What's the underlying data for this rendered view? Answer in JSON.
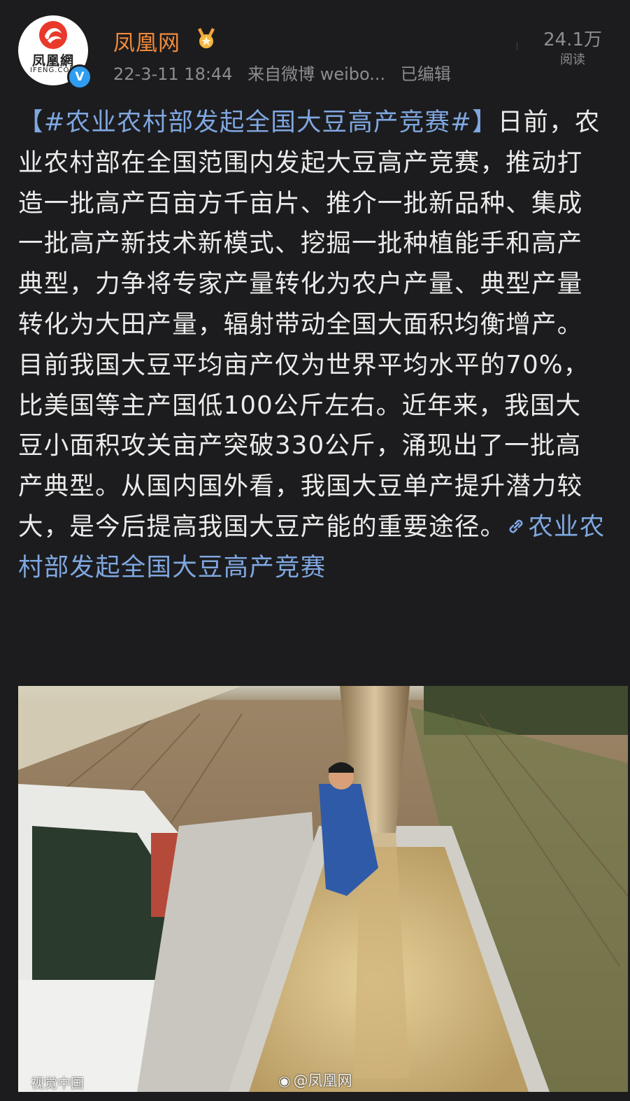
{
  "post": {
    "author": "凤凰网",
    "avatar_brand_cn": "凤凰網",
    "avatar_brand_en": "IFENG.COM",
    "timestamp": "22-3-11 18:44",
    "source": "来自微博 weibo...",
    "edited": "已编辑",
    "read_count": "24.1万",
    "read_label": "阅读",
    "topic": "【#农业农村部发起全国大豆高产竞赛#】",
    "paragraph1": "日前，农业农村部在全国范围内发起大豆高产竞赛，推动打造一批高产百亩方千亩片、推介一批新品种、集成一批高产新技术新模式、挖掘一批种植能手和高产典型，力争将专家产量转化为农户产量、典型产量转化为大田产量，辐射带动全国大面积均衡增产。",
    "paragraph2": "目前我国大豆平均亩产仅为世界平均水平的70%，比美国等主产国低100公斤左右。近年来，我国大豆小面积攻关亩产突破330公斤，涌现出了一批高产典型。从国内国外看，我国大豆单产提升潜力较大，是今后提高我国大豆产能的重要途径。",
    "link_text": "农业农村部发起全国大豆高产竞赛",
    "photo_caption": "视觉中国",
    "photo_watermark": "@凤凰网"
  },
  "icons": {
    "verified": "verified-v-icon",
    "medal": "gold-medal-icon",
    "link": "link-chain-icon",
    "weibo": "weibo-logo-icon"
  },
  "colors": {
    "background": "#1c1c1e",
    "username": "#f08a3c",
    "topic_link": "#7fa7e0",
    "meta": "#8d8d90",
    "verified": "#2f9cf0"
  }
}
